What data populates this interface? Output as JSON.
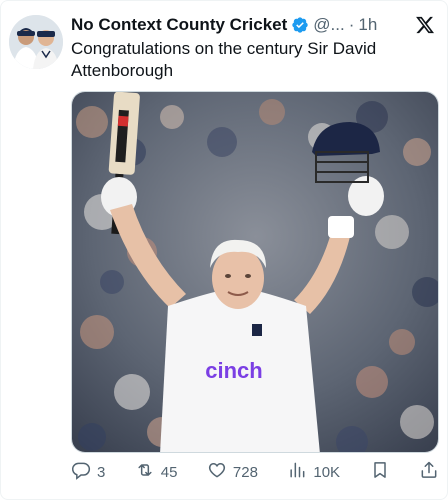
{
  "tweet": {
    "display_name": "No Context County Cricket",
    "handle": "@...",
    "separator": "·",
    "time": "1h",
    "text": "Congratulations on the century Sir David Attenborough",
    "media": {
      "shirt_logo": "cinch"
    }
  },
  "actions": {
    "reply_count": "3",
    "retweet_count": "45",
    "like_count": "728",
    "views_count": "10K"
  },
  "icons": {
    "verified": "verified-badge-icon",
    "platform": "x-logo-icon",
    "reply": "reply-icon",
    "retweet": "retweet-icon",
    "like": "heart-icon",
    "views": "views-chart-icon",
    "bookmark": "bookmark-icon",
    "share": "share-icon"
  },
  "colors": {
    "verified_blue": "#1d9bf0",
    "muted_text": "#536471",
    "text": "#0f1419",
    "shirt_logo_purple": "#7b3fe4"
  }
}
